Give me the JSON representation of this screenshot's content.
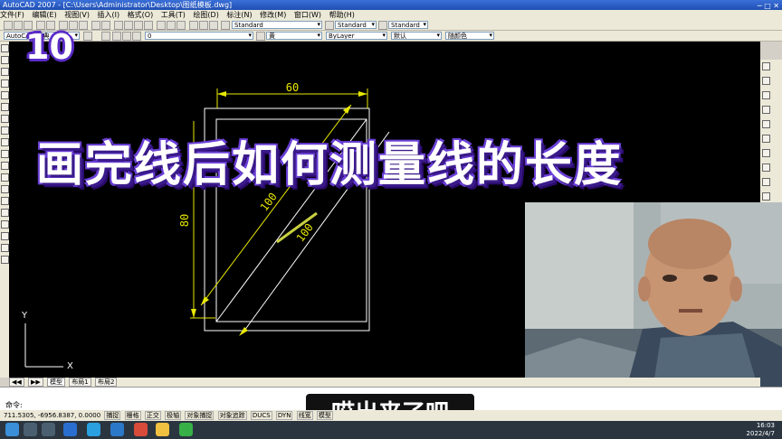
{
  "window": {
    "title": "AutoCAD 2007 - [C:\\Users\\Administrator\\Desktop\\图纸模板.dwg]"
  },
  "menu": [
    "文件(F)",
    "编辑(E)",
    "视图(V)",
    "插入(I)",
    "格式(O)",
    "工具(T)",
    "绘图(D)",
    "标注(N)",
    "修改(M)",
    "窗口(W)",
    "帮助(H)"
  ],
  "toolbar": {
    "style1": "Standard",
    "style2": "Standard",
    "style3": "Standard",
    "workspace": "AutoCAD 经典",
    "layer": "0",
    "color": "黄",
    "linetype": "ByLayer",
    "lineweight": "默认",
    "plotstyle": "随颜色"
  },
  "overlay": {
    "episode": "10",
    "headline": "画完线后如何测量线的长度",
    "subtitle": "哎出来了吧"
  },
  "drawing": {
    "dim_top": "60",
    "dim_left": "80",
    "dim_diag1": "100",
    "dim_diag2": "100",
    "axis_y": "Y",
    "axis_x": "X"
  },
  "tabs": [
    "模型",
    "布局1",
    "布局2"
  ],
  "command": {
    "prompt": "命令:"
  },
  "status": {
    "coords": "711.5305, -6956.8387, 0.0000",
    "toggles": [
      "捕捉",
      "栅格",
      "正交",
      "极轴",
      "对象捕捉",
      "对象追踪",
      "DUCS",
      "DYN",
      "线宽",
      "模型"
    ]
  },
  "taskbar": {
    "time": "16:03",
    "date": "2022/4/7"
  },
  "colors": {
    "dimension": "#e8e800",
    "geometry": "#ffffff",
    "headline_outline": "#5b2cc8"
  }
}
